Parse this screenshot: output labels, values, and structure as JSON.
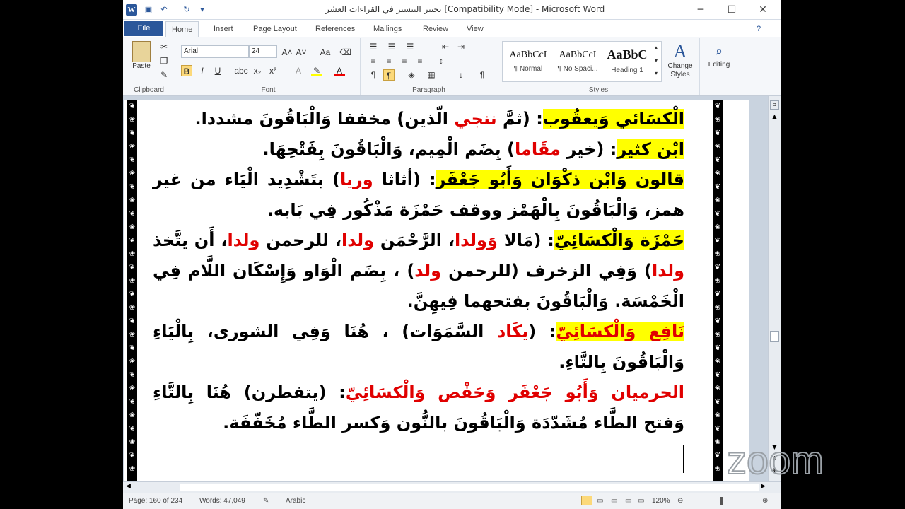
{
  "window": {
    "title": "تحبير التيسير في القراءات العشر [Compatibility Mode]  -  Microsoft Word",
    "minimize": "─",
    "maximize": "☐",
    "close": "✕"
  },
  "quick_access": {
    "logo": "W",
    "save": "💾",
    "undo": "↶",
    "redo": "↻",
    "customize": "⇂"
  },
  "tabs": [
    "File",
    "Home",
    "Insert",
    "Page Layout",
    "References",
    "Mailings",
    "Review",
    "View"
  ],
  "ribbon": {
    "clipboard": {
      "paste": "Paste",
      "label": "Clipboard"
    },
    "font": {
      "name": "Arial",
      "size": "24",
      "label": "Font",
      "bold": "B",
      "italic": "I",
      "underline": "U",
      "strike": "abc",
      "sub": "x₂",
      "sup": "x²",
      "grow": "A˄",
      "shrink": "A˅",
      "case": "Aa"
    },
    "paragraph": {
      "label": "Paragraph"
    },
    "styles": {
      "label": "Styles",
      "items": [
        {
          "preview": "AaBbCcI",
          "name": "¶ Normal"
        },
        {
          "preview": "AaBbCcI",
          "name": "¶ No Spaci..."
        },
        {
          "preview": "AaBbC",
          "name": "Heading 1"
        }
      ],
      "change": "Change Styles"
    },
    "editing": {
      "label": "Editing"
    }
  },
  "document": {
    "lines": [
      [
        {
          "t": "الْكسَائي وَيعقُوب",
          "c": "hl"
        },
        {
          "t": ": (ثمَّ "
        },
        {
          "t": "ننجي",
          "c": "red"
        },
        {
          "t": " الّذين) مخففا وَالْبَاقُونَ مشددا."
        }
      ],
      [
        {
          "t": "ابْن كثير",
          "c": "hl"
        },
        {
          "t": ": (خير "
        },
        {
          "t": "مقَاما",
          "c": "red"
        },
        {
          "t": ") بِضَم الْمِيم، وَالْبَاقُونَ بِفَتْحِهَا."
        }
      ],
      [
        {
          "t": "قالون وَابْن ذكْوَان وَأَبُو جَعْفَر",
          "c": "hl"
        },
        {
          "t": ": (أثاثا "
        },
        {
          "t": "وريا",
          "c": "red"
        },
        {
          "t": ") بتَشْدِيد الْيَاء من غير همز، وَالْبَاقُونَ بِالْهَمْز ووقف حَمْزَة مَذْكُور فِي بَابه."
        }
      ],
      [
        {
          "t": "حَمْزَة وَالْكسَائِيّ",
          "c": "hl"
        },
        {
          "t": ": (مَالا "
        },
        {
          "t": "وَولدا",
          "c": "red"
        },
        {
          "t": "، الرَّحْمَن "
        },
        {
          "t": "ولدا",
          "c": "red"
        },
        {
          "t": "، للرحمن "
        },
        {
          "t": "ولدا",
          "c": "red"
        },
        {
          "t": "، أَن يتَّخذ "
        },
        {
          "t": "ولدا",
          "c": "red"
        },
        {
          "t": ") وَفِي الزخرف (للرحمن "
        },
        {
          "t": "ولد",
          "c": "red"
        },
        {
          "t": ") ، بِضَم الْوَاو وَإِسْكَان اللَّام فِي الْخَمْسَة. وَالْبَاقُونَ بفتحهما فِيهِنَّ."
        }
      ],
      [
        {
          "t": "نَافِع وَالْكسَائِيّ",
          "c": "hl red"
        },
        {
          "t": ": ("
        },
        {
          "t": "يكَاد",
          "c": "red"
        },
        {
          "t": " السَّمَوَات) ، هُنَا وَفِي الشورى، بِالْيَاءِ وَالْبَاقُونَ بِالتَّاءِ."
        }
      ],
      [
        {
          "t": "الحرميان وَأَبُو جَعْفَر وَحَفْص وَالْكسَائِيّ",
          "c": "red"
        },
        {
          "t": ": (يتفطرن) هُنَا بِالتَّاءِ وَفتح الطَّاء مُشَدّدَة وَالْبَاقُونَ بالنُّون وَكسر الطَّاء مُخَفّفَة."
        }
      ]
    ]
  },
  "status": {
    "page": "Page: 160 of 234",
    "words": "Words: 47,049",
    "language": "Arabic",
    "zoom": "120%"
  },
  "watermark": "zoom"
}
